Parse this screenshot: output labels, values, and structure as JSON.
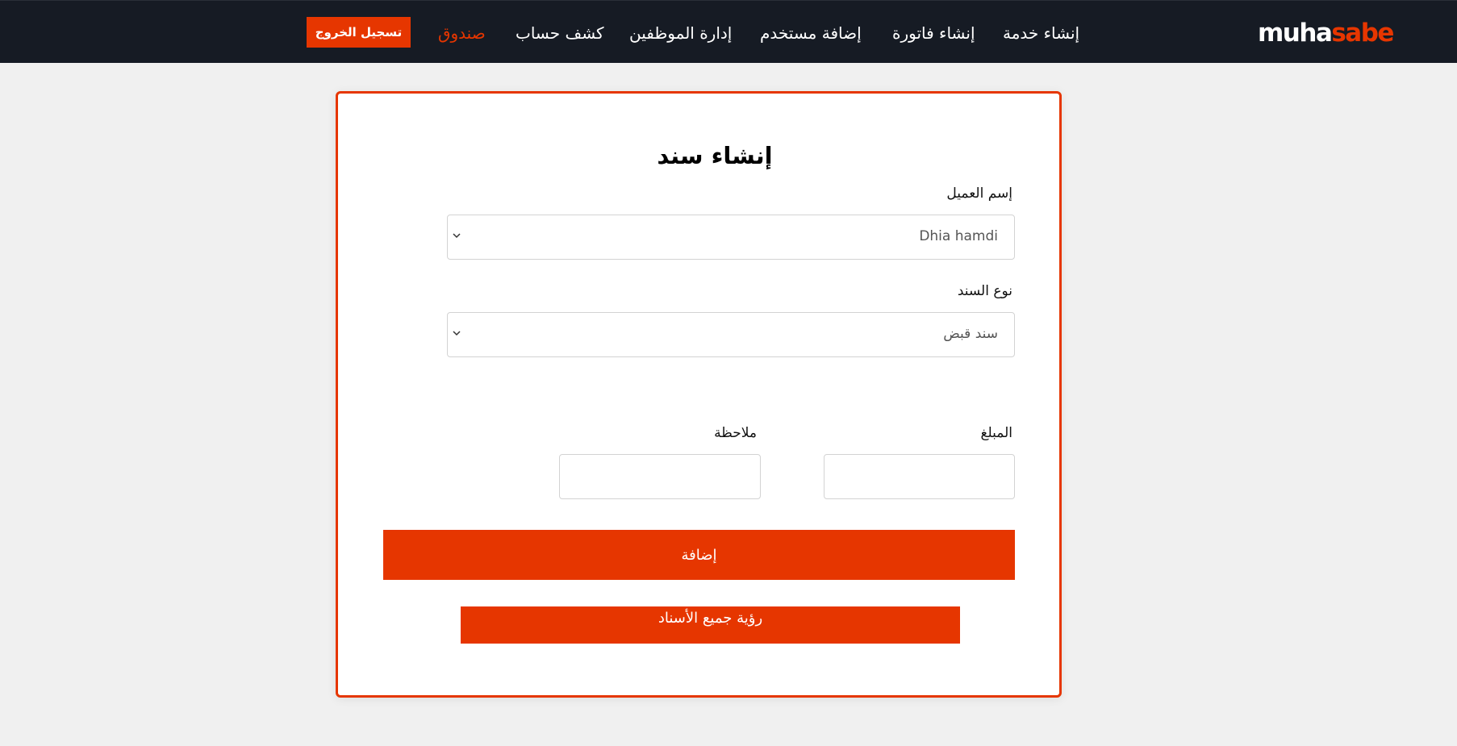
{
  "brand": {
    "part1": "muha",
    "part2": "sabe"
  },
  "nav": {
    "items": [
      {
        "label": "إنشاء خدمة"
      },
      {
        "label": "إنشاء فاتورة"
      },
      {
        "label": "إضافة مستخدم"
      },
      {
        "label": "إدارة الموظفين"
      },
      {
        "label": "كشف حساب"
      },
      {
        "label": "صندوق"
      }
    ],
    "logout_label": "تسجيل الخروج"
  },
  "form": {
    "title": "إنشاء سند",
    "client": {
      "label": "إسم العميل",
      "value": "Dhia hamdi"
    },
    "voucher_type": {
      "label": "نوع السند",
      "value": "سند قبض"
    },
    "amount": {
      "label": "المبلغ",
      "value": ""
    },
    "note": {
      "label": "ملاحظة",
      "value": ""
    },
    "submit_label": "إضافة",
    "view_all_label": "رؤية جميع الأسناد"
  },
  "colors": {
    "accent": "#e63600",
    "navbar": "#161b24",
    "background": "#f0f0f0"
  },
  "icons": {
    "select_chevron": "chevron-down-icon"
  }
}
